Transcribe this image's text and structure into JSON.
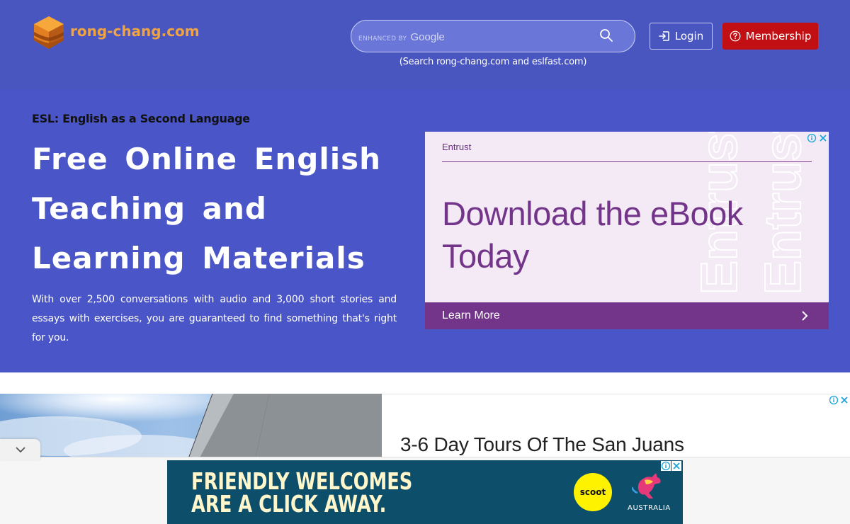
{
  "header": {
    "logo_text": "rong-chang.com",
    "search": {
      "enhanced_label": "ENHANCED BY",
      "provider": "Google",
      "caption": "(Search rong-chang.com and eslfast.com)"
    },
    "login_label": "Login",
    "membership_label": "Membership"
  },
  "hero": {
    "kicker": "ESL: English as a Second Language",
    "title": "Free Online English Teaching and Learning Materials",
    "description": "With over 2,500 conversations with audio and 3,000 short stories and essays with exercises, you are guaranteed to find something that's right for you."
  },
  "ad1": {
    "brand": "Entrust",
    "headline_line1": "Download the eBook",
    "headline_line2": "Today",
    "cta": "Learn More",
    "watermark": "Entrust"
  },
  "ad2": {
    "headline": "3-6 Day Tours Of The San Juans"
  },
  "ad3": {
    "line1": "FRIENDLY WELCOMES",
    "line2": "ARE A CLICK AWAY.",
    "logo_text": "scoot",
    "country": "AUSTRALIA"
  },
  "colors": {
    "header_bg": "#4a56c0",
    "hero_bg": "#4a55c8",
    "logo_orange": "#f0a343",
    "membership_red": "#c20f14",
    "ad_purple": "#733589",
    "ad_bg": "#f3eaf5",
    "scoot_teal": "#0d4e6b",
    "scoot_yellow": "#fff200"
  }
}
